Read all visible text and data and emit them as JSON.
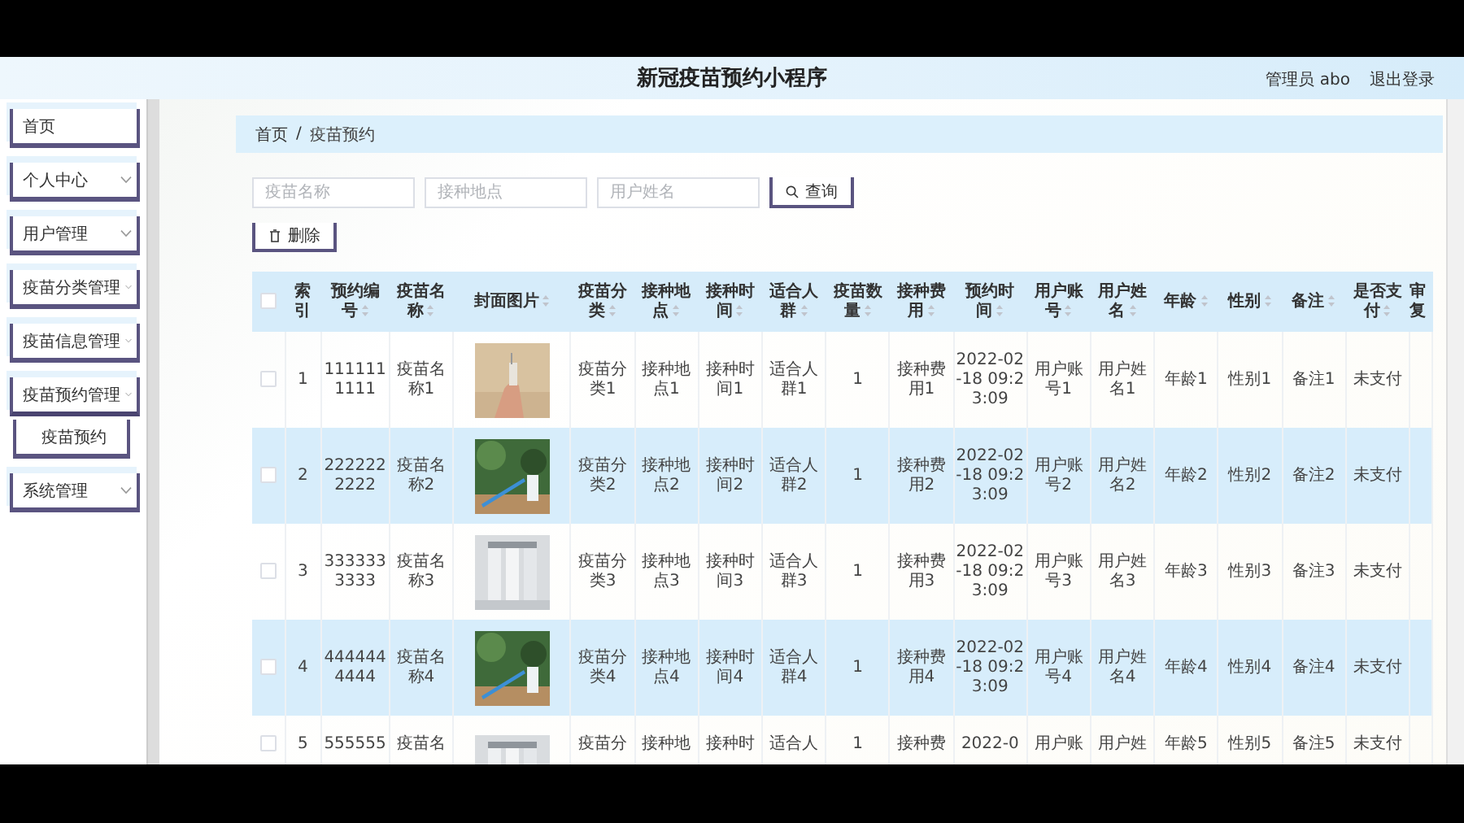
{
  "header": {
    "title": "新冠疫苗预约小程序",
    "user": "管理员 abo",
    "logout": "退出登录"
  },
  "sidebar": {
    "items": [
      {
        "label": "首页",
        "kind": "link"
      },
      {
        "label": "个人中心",
        "kind": "menu"
      },
      {
        "label": "用户管理",
        "kind": "menu"
      },
      {
        "label": "疫苗分类管理",
        "kind": "menu"
      },
      {
        "label": "疫苗信息管理",
        "kind": "menu"
      },
      {
        "label": "疫苗预约管理",
        "kind": "menu",
        "expanded": true,
        "children": [
          {
            "label": "疫苗预约"
          }
        ]
      },
      {
        "label": "系统管理",
        "kind": "menu"
      }
    ]
  },
  "breadcrumb": {
    "items": [
      "首页",
      "疫苗预约"
    ],
    "separator": "/"
  },
  "search": {
    "fields": [
      {
        "placeholder": "疫苗名称"
      },
      {
        "placeholder": "接种地点"
      },
      {
        "placeholder": "用户姓名"
      }
    ],
    "button": "查询"
  },
  "delete_button": "删除",
  "table": {
    "select_all_checked": false,
    "columns": [
      {
        "label": "索引",
        "kind": "text",
        "sortable": false
      },
      {
        "label": "预约编号",
        "kind": "text",
        "sortable": true
      },
      {
        "label": "疫苗名称",
        "kind": "text",
        "sortable": true
      },
      {
        "label": "封面图片",
        "kind": "picture",
        "sortable": true
      },
      {
        "label": "疫苗分类",
        "kind": "text",
        "sortable": true
      },
      {
        "label": "接种地点",
        "kind": "text",
        "sortable": true
      },
      {
        "label": "接种时间",
        "kind": "text",
        "sortable": true
      },
      {
        "label": "适合人群",
        "kind": "text",
        "sortable": true
      },
      {
        "label": "疫苗数量",
        "kind": "text",
        "sortable": true
      },
      {
        "label": "接种费用",
        "kind": "text",
        "sortable": true
      },
      {
        "label": "预约时间",
        "kind": "text",
        "sortable": true
      },
      {
        "label": "用户账号",
        "kind": "text",
        "sortable": true
      },
      {
        "label": "用户姓名",
        "kind": "text",
        "sortable": true
      },
      {
        "label": "年龄",
        "kind": "text",
        "sortable": true
      },
      {
        "label": "性别",
        "kind": "text",
        "sortable": true
      },
      {
        "label": "备注",
        "kind": "text",
        "sortable": true
      },
      {
        "label": "是否支付",
        "kind": "text",
        "sortable": true
      },
      {
        "label": "审复",
        "kind": "cut",
        "sortable": false
      }
    ],
    "rows": [
      {
        "checked": false,
        "cells": [
          "1",
          "1111111111",
          "疫苗名称1",
          "",
          "疫苗分类1",
          "接种地点1",
          "接种时间1",
          "适合人群1",
          "1",
          "接种费用1",
          "2022-02-18 09:23:09",
          "用户账号1",
          "用户姓名1",
          "年龄1",
          "性别1",
          "备注1",
          "未支付"
        ]
      },
      {
        "checked": false,
        "cells": [
          "2",
          "2222222222",
          "疫苗名称2",
          "",
          "疫苗分类2",
          "接种地点2",
          "接种时间2",
          "适合人群2",
          "1",
          "接种费用2",
          "2022-02-18 09:23:09",
          "用户账号2",
          "用户姓名2",
          "年龄2",
          "性别2",
          "备注2",
          "未支付"
        ]
      },
      {
        "checked": false,
        "cells": [
          "3",
          "3333333333",
          "疫苗名称3",
          "",
          "疫苗分类3",
          "接种地点3",
          "接种时间3",
          "适合人群3",
          "1",
          "接种费用3",
          "2022-02-18 09:23:09",
          "用户账号3",
          "用户姓名3",
          "年龄3",
          "性别3",
          "备注3",
          "未支付"
        ]
      },
      {
        "checked": false,
        "cells": [
          "4",
          "4444444444",
          "疫苗名称4",
          "",
          "疫苗分类4",
          "接种地点4",
          "接种时间4",
          "适合人群4",
          "1",
          "接种费用4",
          "2022-02-18 09:23:09",
          "用户账号4",
          "用户姓名4",
          "年龄4",
          "性别4",
          "备注4",
          "未支付"
        ]
      },
      {
        "checked": false,
        "cells": [
          "5",
          "555555",
          "疫苗名",
          "",
          "疫苗分",
          "接种地",
          "接种时",
          "适合人",
          "1",
          "接种费",
          "2022-0",
          "用户账",
          "用户姓",
          "年龄5",
          "性别5",
          "备注5",
          "未支付"
        ]
      }
    ]
  }
}
